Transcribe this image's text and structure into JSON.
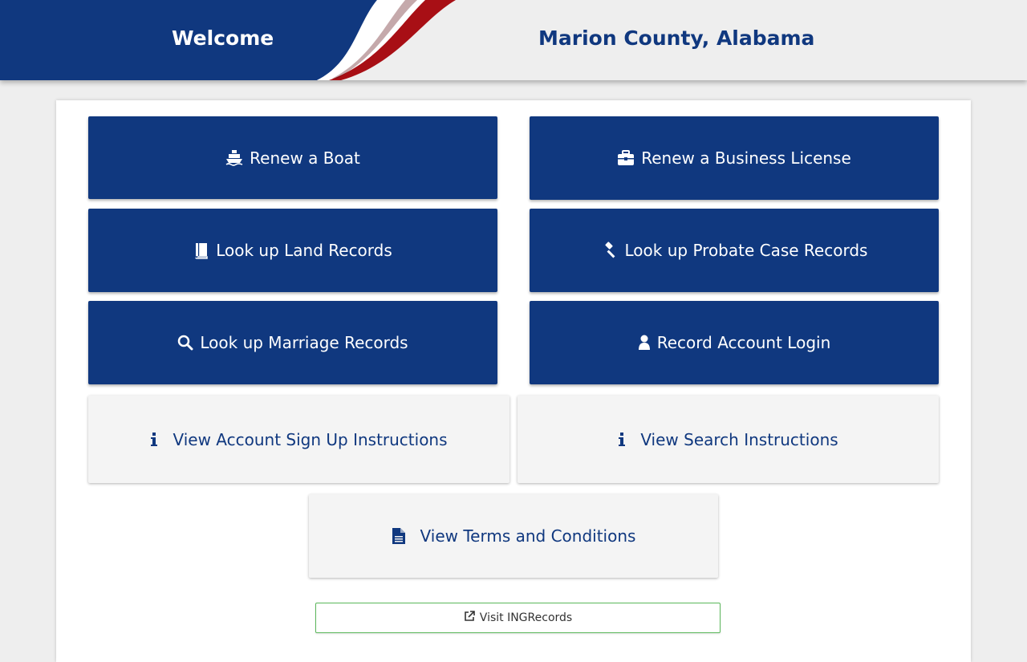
{
  "header": {
    "welcome": "Welcome",
    "county": "Marion County, Alabama",
    "colors": {
      "navy": "#10387f",
      "red": "#a80f15",
      "white": "#ffffff",
      "background": "#eeeeee"
    }
  },
  "buttons": [
    {
      "label": "Renew a Boat",
      "icon": "ship-icon"
    },
    {
      "label": "Renew a Business License",
      "icon": "briefcase-icon"
    },
    {
      "label": "Look up Land Records",
      "icon": "book-icon"
    },
    {
      "label": "Look up Probate Case Records",
      "icon": "gavel-icon"
    },
    {
      "label": "Look up Marriage Records",
      "icon": "search-icon"
    },
    {
      "label": "Record Account Login",
      "icon": "user-icon"
    }
  ],
  "instructions": [
    {
      "label": "View Account Sign Up Instructions",
      "icon": "info-icon"
    },
    {
      "label": "View Search Instructions",
      "icon": "info-icon"
    },
    {
      "label": "View Terms and Conditions",
      "icon": "file-text-icon"
    }
  ],
  "external_link": {
    "label": "Visit INGRecords",
    "icon": "external-link-icon",
    "border_color": "#5cb85c"
  }
}
